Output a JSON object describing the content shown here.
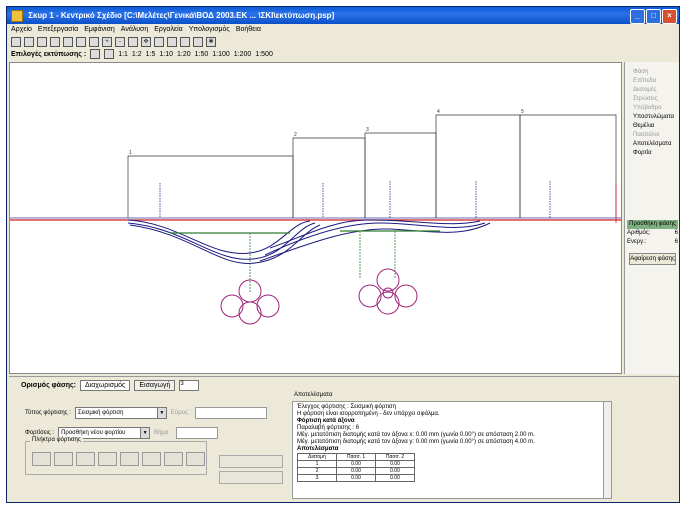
{
  "window": {
    "title": "Σκυρ 1 - Κεντρικό Σχέδιο [C:\\Μελέτες\\Γενικά\\ΒΟΔ 2003.ΕΚ ... \\ΣΚΙ\\εκτύπωση.psp]"
  },
  "menu": [
    "Αρχείο",
    "Επεξεργασία",
    "Εμφάνιση",
    "Ανάλυση",
    "Εργαλεία",
    "Υπολογισμός",
    "Βοήθεια"
  ],
  "toolbar2": {
    "label": "Επιλογές εκτύπωσης :",
    "ticks": [
      "1:1",
      "1:2",
      "1:5",
      "1:10",
      "1:20",
      "1:50",
      "1:100",
      "1:200",
      "1:500"
    ]
  },
  "colors": {
    "accent": "#2b73e8",
    "profile": "#1a1a80",
    "green": "#2e7d32",
    "pile": "#a0247a",
    "red": "#d02020"
  },
  "right_panel": {
    "items": [
      {
        "label": "Φάση",
        "on": false
      },
      {
        "label": "Επίπεδα",
        "on": false
      },
      {
        "label": "Διατομές",
        "on": false
      },
      {
        "label": "Στρώσεις",
        "on": false
      },
      {
        "label": "Υπόβαθρο",
        "on": false
      },
      {
        "label": "Υποστυλώματα",
        "on": true
      },
      {
        "label": "Θεμέλια",
        "on": true
      },
      {
        "label": "Πασσάλοι",
        "on": false
      },
      {
        "label": "Αποτελέσματα",
        "on": true
      },
      {
        "label": "Φορτία",
        "on": true
      }
    ],
    "button": "Προσθήκη φάσης",
    "rows": [
      {
        "k": "Αριθμός:",
        "v": "6"
      },
      {
        "k": "Ενεργ.:",
        "v": "6"
      }
    ],
    "button2": "Αφαίρεση φάσης"
  },
  "bottom": {
    "title": "Ορισμός φάσης:",
    "tab1": "Διαχωρισμός",
    "tab2": "Εισαγωγή",
    "count": "3",
    "type_label": "Τύπος φόρτισης :",
    "type_value": "Σεισμική φόρτιση",
    "load_label": "Φορτίσεις :",
    "load_value": "Προσθήκη νέου φορτίου",
    "field_a": "Εύρος :",
    "field_b": "Βήμα :",
    "group_label": "Πλήκτρα φόρτισης",
    "info_title": "Αποτελέσματα",
    "info_lines": [
      "Έλεγχος φόρτισης : Σεισμική φόρτιση",
      "Η φόρτιση είναι ισορροπημένη - δεν υπάρχει σφάλμα.",
      "Φόρτιση κατά άξονα",
      "Παραλαβή φόρτισης : 6",
      "Μέγ. μετατόπιση διατομής κατά τον άξονα x: 0.00 mm (γωνία 0.00°) σε απόσταση 2.00 m.",
      "Μέγ. μετατόπιση διατομής κατά τον άξονα y: 0.00 mm (γωνία 0.00°) σε απόσταση 4.00 m."
    ],
    "table_head": [
      "Διατομή",
      "Πασσ. 1",
      "Πασσ. 2"
    ],
    "table_rows": [
      [
        "1",
        "0.00",
        "0.00"
      ],
      [
        "2",
        "0.00",
        "0.00"
      ],
      [
        "3",
        "0.00",
        "0.00"
      ]
    ],
    "table_caption": "Αποτελέσματα"
  }
}
